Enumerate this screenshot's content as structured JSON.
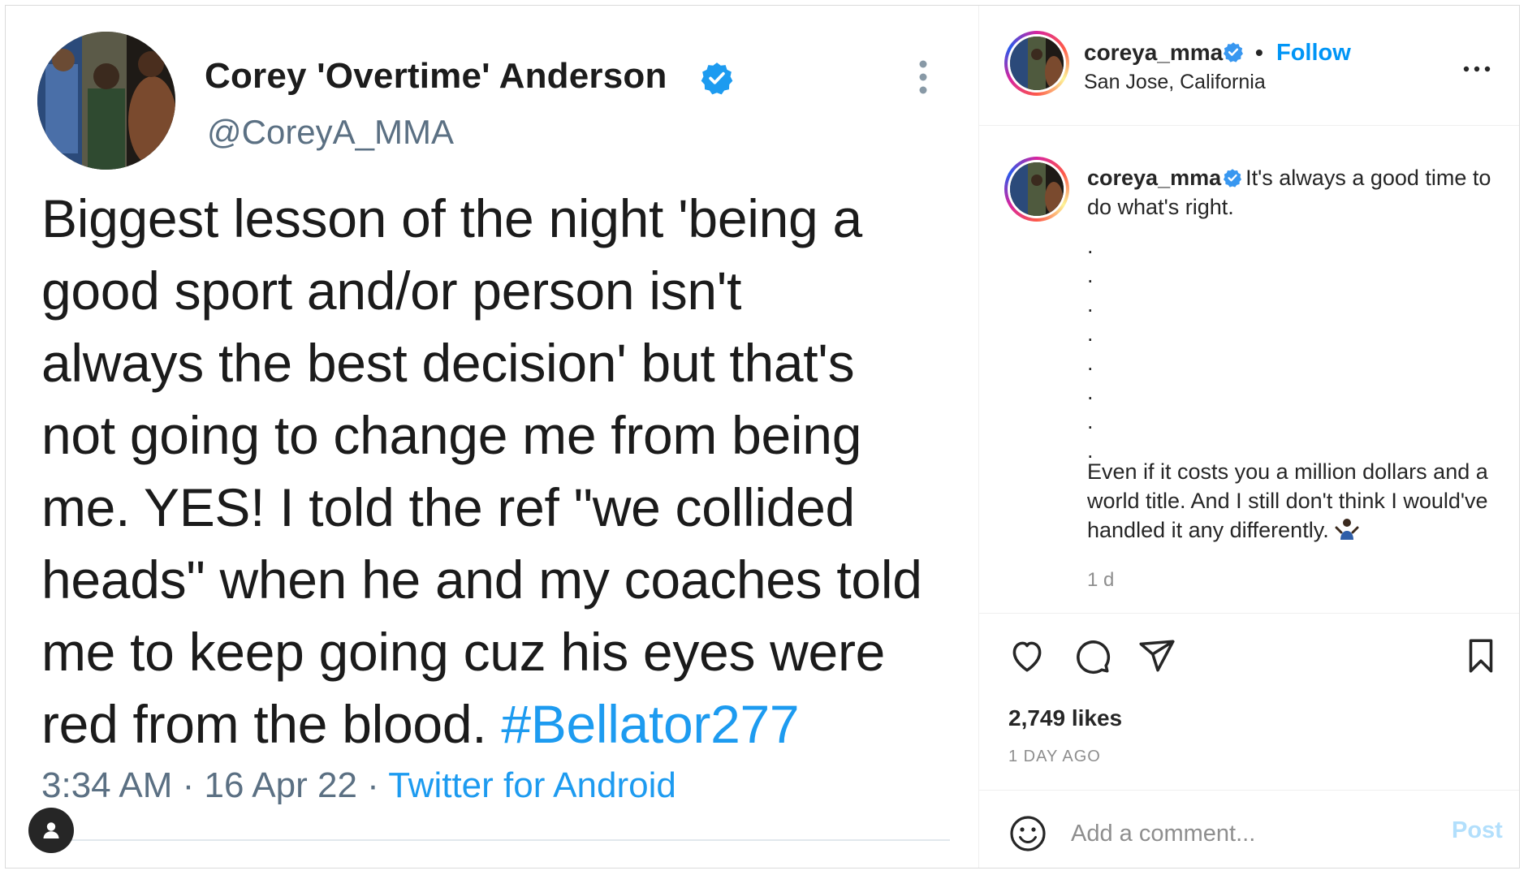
{
  "tweet": {
    "display_name": "Corey 'Overtime' Anderson",
    "handle": "@CoreyA_MMA",
    "lines": [
      "Biggest lesson of the night 'being a",
      "good sport and/or person isn't",
      "always the best decision' but that's",
      "not going to change me from being",
      "me. YES! I told the ref \"we collided",
      "heads\" when he and my coaches told",
      "me to keep going cuz his eyes were",
      "red from the blood. "
    ],
    "hashtag": "#Bellator277",
    "time": "3:34 AM",
    "date": "16 Apr 22",
    "separator": " · ",
    "source": "Twitter for Android"
  },
  "post_header": {
    "username": "coreya_mma",
    "dot": "•",
    "follow_label": "Follow",
    "location": "San Jose, California"
  },
  "caption": {
    "username": "coreya_mma",
    "text": "It's always a good time to do what's right.",
    "dots": [
      ".",
      ".",
      ".",
      ".",
      ".",
      ".",
      ".",
      "."
    ],
    "text2": "Even if it costs you a million dollars and a world title. And I still don't think I would've handled it any differently.",
    "time": "1 d"
  },
  "actions": {
    "likes": "2,749 likes",
    "posted_ago": "1 DAY AGO"
  },
  "comment": {
    "placeholder": "Add a comment...",
    "post_label": "Post"
  },
  "colors": {
    "accent": "#0095f6",
    "twitter_blue": "#1d9bf0",
    "verified": "#3897f0",
    "muted": "#8e8e8e",
    "post_disabled": "#b2dffc"
  },
  "icons": {
    "header_more": "more-horizontal-icon",
    "like": "heart-icon",
    "comment": "comment-bubble-icon",
    "share": "paper-plane-icon",
    "save": "bookmark-icon",
    "emoji": "smiley-icon",
    "tag": "user-tag-icon"
  }
}
